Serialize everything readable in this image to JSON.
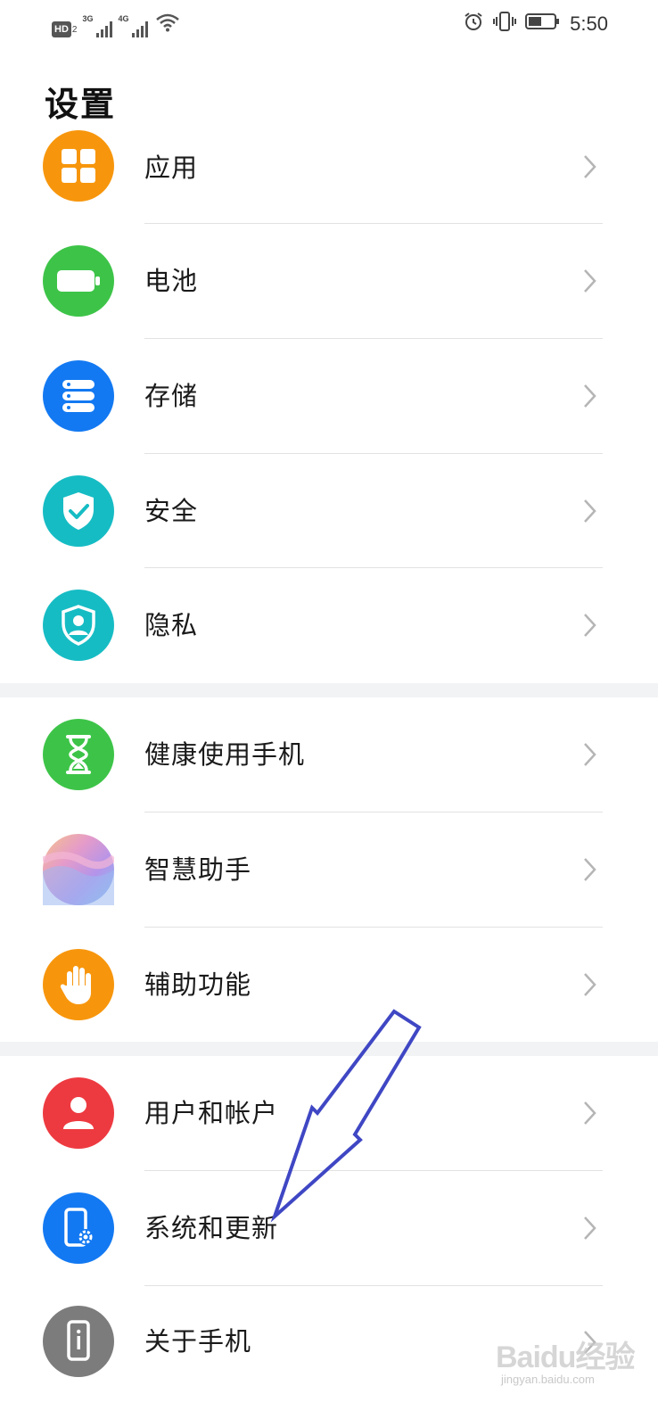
{
  "status_bar": {
    "hd_badge": "HD",
    "hd_sub": "2",
    "network_1": "3G",
    "network_2": "4G",
    "time": "5:50",
    "icons": [
      "wifi-icon",
      "alarm-icon",
      "vibrate-icon",
      "battery-icon"
    ]
  },
  "page": {
    "title": "设置"
  },
  "settings": [
    {
      "label": "应用",
      "icon": "apps-icon",
      "color": "#F7960C"
    },
    {
      "label": "电池",
      "icon": "battery-icon",
      "color": "#3DC448"
    },
    {
      "label": "存储",
      "icon": "storage-icon",
      "color": "#1379F2"
    },
    {
      "label": "安全",
      "icon": "shield-check-icon",
      "color": "#16BCC4"
    },
    {
      "label": "隐私",
      "icon": "privacy-icon",
      "color": "#16BCC4"
    },
    {
      "label": "健康使用手机",
      "icon": "hourglass-icon",
      "color": "#3DC448"
    },
    {
      "label": "智慧助手",
      "icon": "assistant-icon",
      "color": "#C89BE0"
    },
    {
      "label": "辅助功能",
      "icon": "hand-icon",
      "color": "#F7960C"
    },
    {
      "label": "用户和帐户",
      "icon": "user-icon",
      "color": "#ED3A40"
    },
    {
      "label": "系统和更新",
      "icon": "system-update-icon",
      "color": "#1379F2"
    },
    {
      "label": "关于手机",
      "icon": "about-phone-icon",
      "color": "#7C7C7C"
    }
  ],
  "annotation": {
    "arrow_color": "#3F47C4"
  },
  "watermark": {
    "main": "Baidu经验",
    "sub": "jingyan.baidu.com"
  }
}
